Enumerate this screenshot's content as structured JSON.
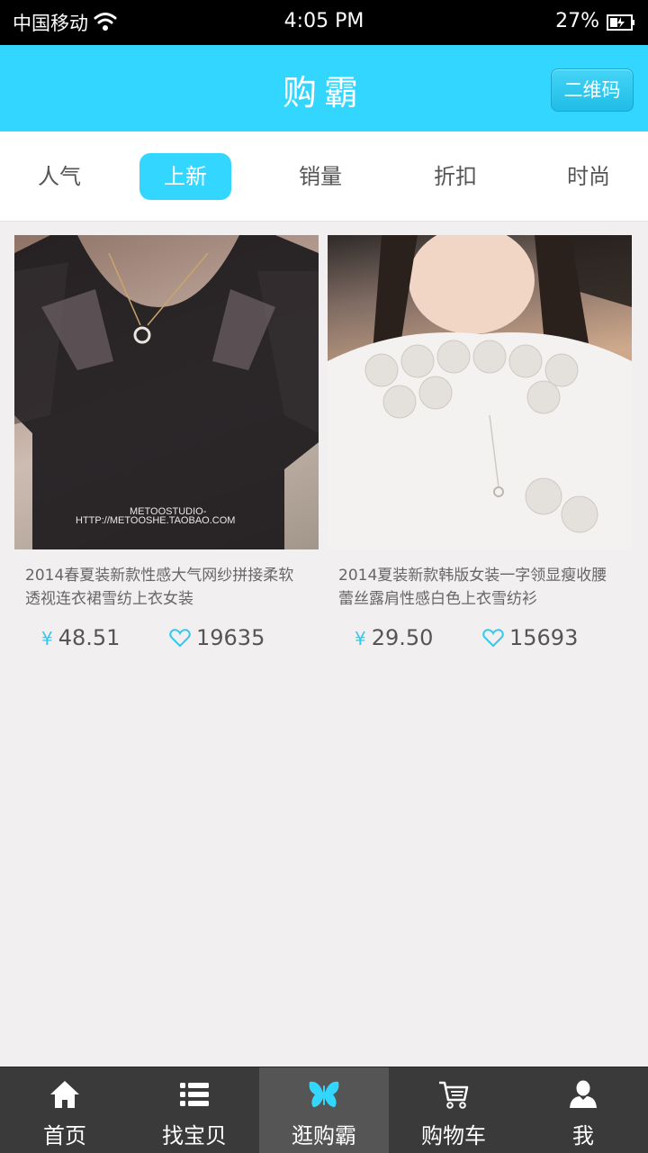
{
  "status_bar": {
    "carrier": "中国移动",
    "time": "4:05 PM",
    "battery": "27%"
  },
  "header": {
    "title": "购霸",
    "qr_button": "二维码"
  },
  "tabs": [
    {
      "label": "人气",
      "active": false
    },
    {
      "label": "上新",
      "active": true
    },
    {
      "label": "销量",
      "active": false
    },
    {
      "label": "折扣",
      "active": false
    },
    {
      "label": "时尚",
      "active": false
    }
  ],
  "products": [
    {
      "description": "2014春夏装新款性感大气网纱拼接柔软透视连衣裙雪纺上衣女装",
      "watermark_line1": "METOOSTUDIO-",
      "watermark_line2": "HTTP://METOOSHE.TAOBAO.COM",
      "currency": "¥",
      "price": "48.51",
      "likes": "19635"
    },
    {
      "description": "2014夏装新款韩版女装一字领显瘦收腰蕾丝露肩性感白色上衣雪纺衫",
      "currency": "¥",
      "price": "29.50",
      "likes": "15693"
    }
  ],
  "bottom_nav": [
    {
      "label": "首页",
      "icon": "home-icon"
    },
    {
      "label": "找宝贝",
      "icon": "list-icon"
    },
    {
      "label": "逛购霸",
      "icon": "butterfly-icon",
      "active": true
    },
    {
      "label": "购物车",
      "icon": "cart-icon"
    },
    {
      "label": "我",
      "icon": "user-icon"
    }
  ],
  "colors": {
    "accent": "#33d6fe",
    "nav_bg": "#3a3a3a",
    "page_bg": "#f2eff0"
  }
}
